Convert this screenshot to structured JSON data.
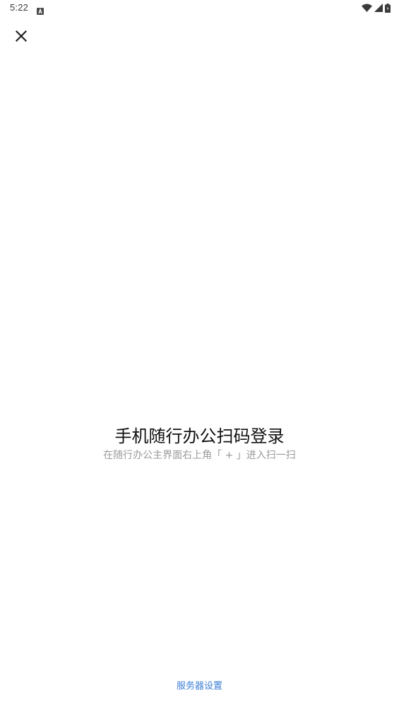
{
  "status_bar": {
    "time": "5:22",
    "notification_icon": "font-icon",
    "right_icons": [
      "wifi-icon",
      "signal-icon",
      "battery-icon"
    ]
  },
  "header": {
    "close_icon": "close-icon"
  },
  "main": {
    "title": "手机随行办公扫码登录",
    "hint": "在随行办公主界面右上角「 + 」进入扫一扫"
  },
  "footer": {
    "server_settings_label": "服务器设置"
  },
  "colors": {
    "link": "#3d7fd6",
    "title": "#111111",
    "hint": "#9a9a9a",
    "background": "#ffffff"
  }
}
